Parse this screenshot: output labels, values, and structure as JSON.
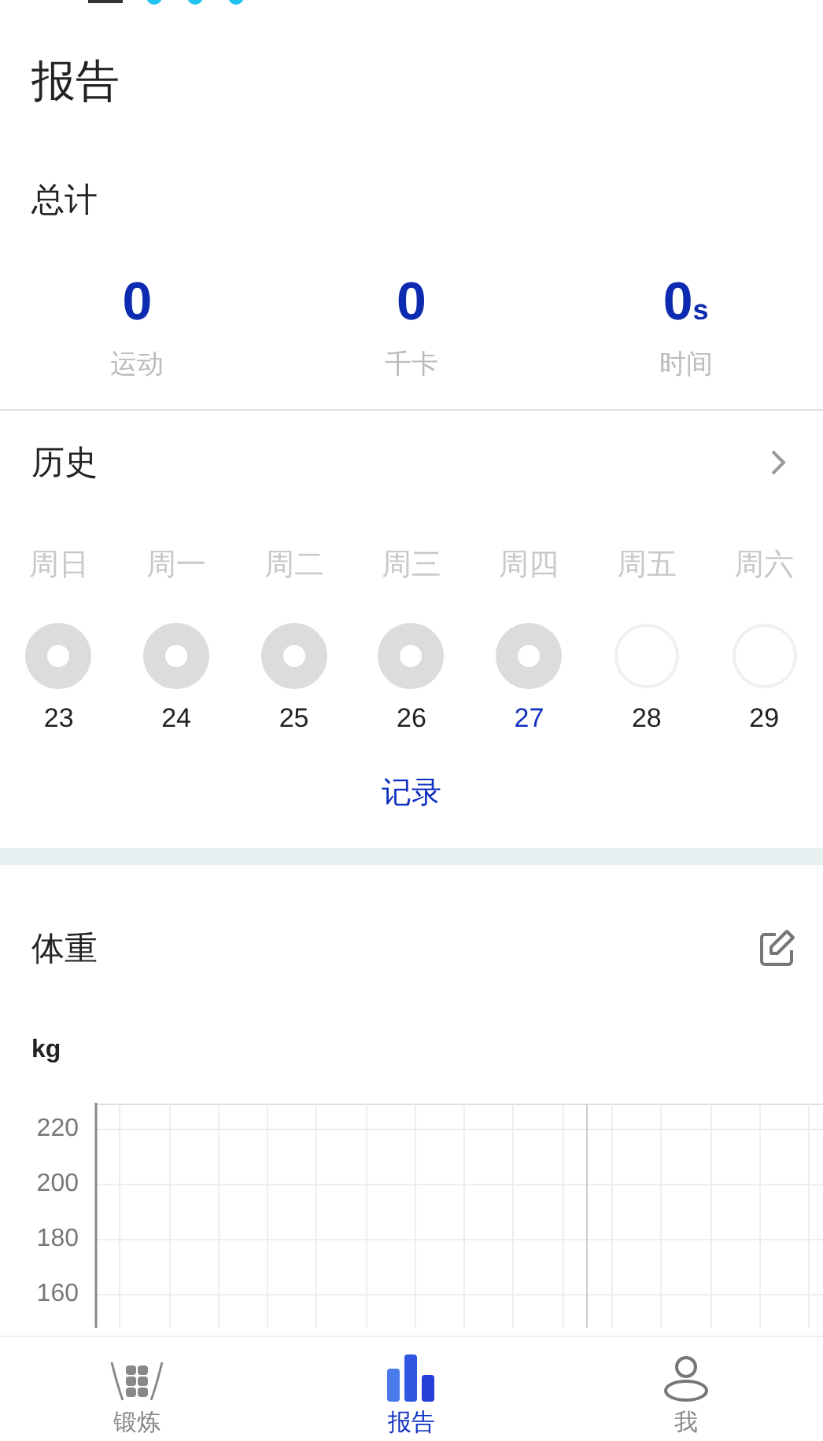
{
  "title": "报告",
  "totals": {
    "heading": "总计",
    "stats": [
      {
        "value": "0",
        "label": "运动"
      },
      {
        "value": "0",
        "label": "千卡"
      },
      {
        "value": "0",
        "unit": "s",
        "label": "时间"
      }
    ]
  },
  "history": {
    "heading": "历史",
    "days": [
      {
        "weekday": "周日",
        "date": "23",
        "done": true,
        "selected": false
      },
      {
        "weekday": "周一",
        "date": "24",
        "done": true,
        "selected": false
      },
      {
        "weekday": "周二",
        "date": "25",
        "done": true,
        "selected": false
      },
      {
        "weekday": "周三",
        "date": "26",
        "done": true,
        "selected": false
      },
      {
        "weekday": "周四",
        "date": "27",
        "done": true,
        "selected": true
      },
      {
        "weekday": "周五",
        "date": "28",
        "done": false,
        "selected": false
      },
      {
        "weekday": "周六",
        "date": "29",
        "done": false,
        "selected": false
      }
    ],
    "link": "记录"
  },
  "weight": {
    "heading": "体重",
    "unit": "kg",
    "y_ticks": [
      "220",
      "200",
      "180",
      "160"
    ]
  },
  "nav": [
    {
      "label": "锻炼",
      "kind": "abs",
      "selected": false
    },
    {
      "label": "报告",
      "kind": "chart",
      "selected": true
    },
    {
      "label": "我",
      "kind": "person",
      "selected": false
    }
  ]
}
